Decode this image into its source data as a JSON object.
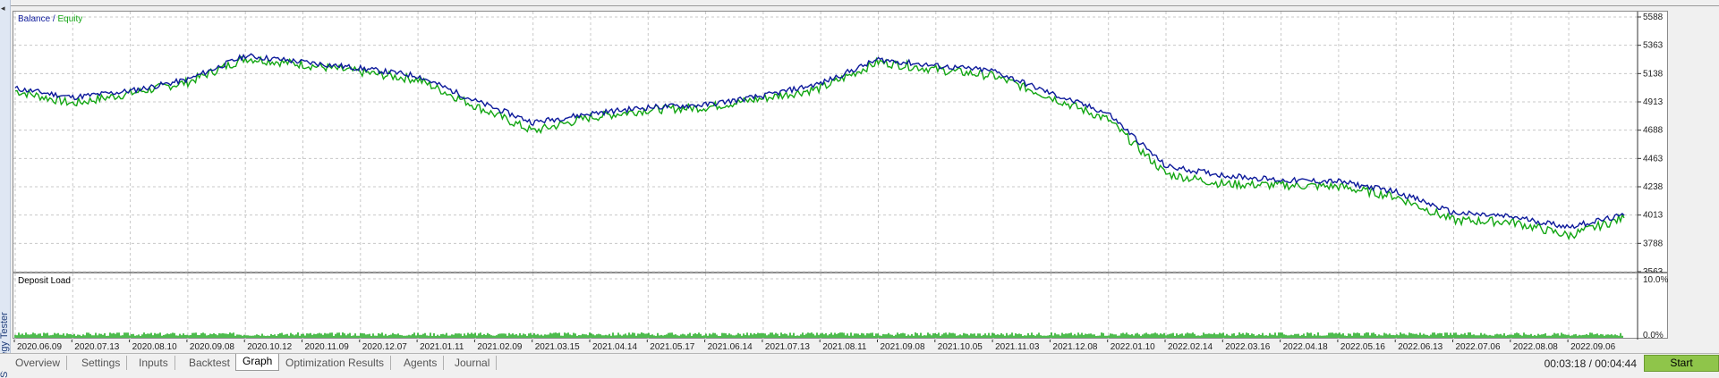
{
  "window": {
    "side_caption": "Strategy Tester"
  },
  "main_chart": {
    "legend_balance": "Balance",
    "legend_sep": " / ",
    "legend_equity": "Equity",
    "colors": {
      "balance": "#0d1a9b",
      "equity": "#13a613",
      "grid": "#c8c8c8"
    },
    "y_ticks": [
      "5588",
      "5363",
      "5138",
      "4913",
      "4688",
      "4463",
      "4238",
      "4013",
      "3788",
      "3563"
    ],
    "y_range": [
      3563,
      5588
    ]
  },
  "deposit_chart": {
    "label": "Deposit Load",
    "y_ticks": [
      "10.0%",
      "0.0%"
    ],
    "color": "#13a613"
  },
  "x_ticks": [
    "2020.06.09",
    "2020.07.13",
    "2020.08.10",
    "2020.09.08",
    "2020.10.12",
    "2020.11.09",
    "2020.12.07",
    "2021.01.11",
    "2021.02.09",
    "2021.03.15",
    "2021.04.14",
    "2021.05.17",
    "2021.06.14",
    "2021.07.13",
    "2021.08.11",
    "2021.09.08",
    "2021.10.05",
    "2021.11.03",
    "2021.12.08",
    "2022.01.10",
    "2022.02.14",
    "2022.03.16",
    "2022.04.18",
    "2022.05.16",
    "2022.06.13",
    "2022.07.06",
    "2022.08.08",
    "2022.09.06"
  ],
  "chart_data": {
    "type": "line",
    "title": "",
    "x": [
      "2020.06.09",
      "2020.07.13",
      "2020.08.10",
      "2020.09.08",
      "2020.10.12",
      "2020.11.09",
      "2020.12.07",
      "2021.01.11",
      "2021.02.09",
      "2021.03.15",
      "2021.04.14",
      "2021.05.17",
      "2021.06.14",
      "2021.07.13",
      "2021.08.11",
      "2021.09.08",
      "2021.10.05",
      "2021.11.03",
      "2021.12.08",
      "2022.01.10",
      "2022.02.14",
      "2022.03.16",
      "2022.04.18",
      "2022.05.16",
      "2022.06.13",
      "2022.07.06",
      "2022.08.08",
      "2022.09.06",
      "2022.09.20"
    ],
    "series": [
      {
        "name": "Balance",
        "values": [
          5020,
          4950,
          5000,
          5090,
          5280,
          5230,
          5180,
          5120,
          4920,
          4750,
          4820,
          4870,
          4890,
          4960,
          5060,
          5250,
          5200,
          5160,
          4980,
          4820,
          4400,
          4330,
          4290,
          4280,
          4200,
          4030,
          4000,
          3920,
          4010
        ]
      },
      {
        "name": "Equity",
        "values": [
          5000,
          4900,
          4980,
          5070,
          5260,
          5210,
          5150,
          5090,
          4880,
          4680,
          4790,
          4850,
          4870,
          4940,
          5020,
          5230,
          5170,
          5120,
          4950,
          4770,
          4340,
          4260,
          4250,
          4240,
          4160,
          3970,
          3960,
          3850,
          3990
        ]
      }
    ],
    "ylim": [
      3563,
      5588
    ],
    "grid": true,
    "legend": "top-left"
  },
  "tabs": [
    {
      "label": "Overview",
      "active": false
    },
    {
      "label": "Settings",
      "active": false
    },
    {
      "label": "Inputs",
      "active": false
    },
    {
      "label": "Backtest",
      "active": false
    },
    {
      "label": "Graph",
      "active": true
    },
    {
      "label": "Optimization Results",
      "active": false
    },
    {
      "label": "Agents",
      "active": false
    },
    {
      "label": "Journal",
      "active": false
    }
  ],
  "timer": "00:03:18 / 00:04:44",
  "start_button": "Start"
}
